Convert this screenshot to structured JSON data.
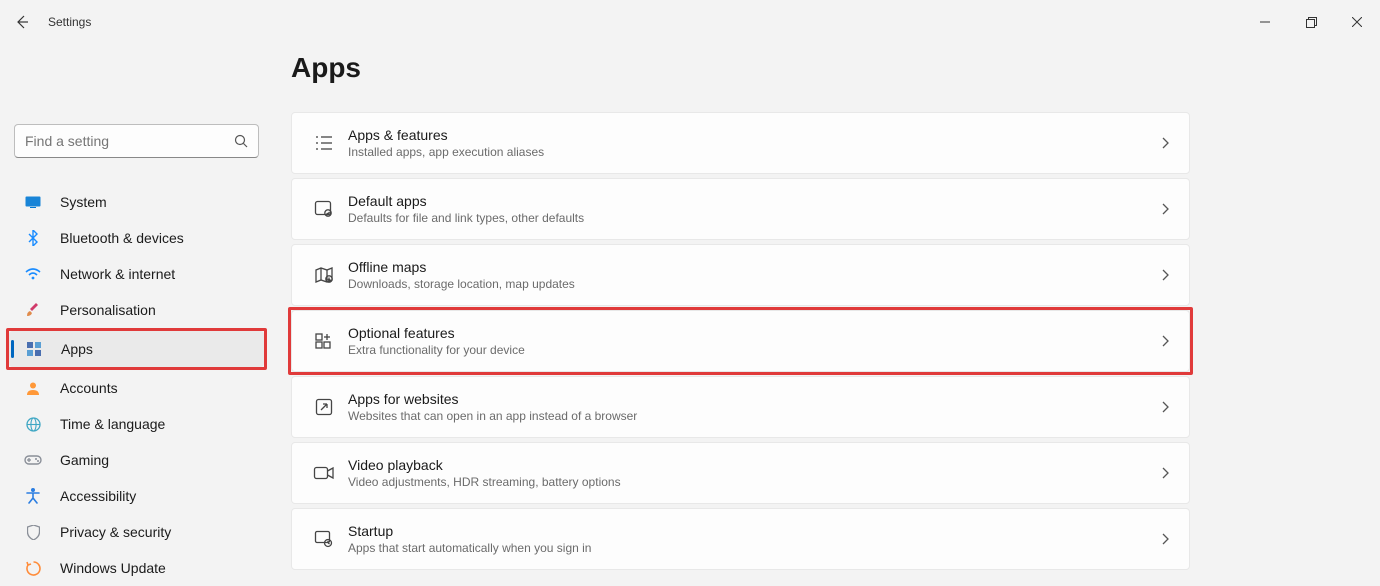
{
  "window": {
    "title": "Settings"
  },
  "search": {
    "placeholder": "Find a setting"
  },
  "sidebar": {
    "items": [
      {
        "label": "System",
        "icon": "system",
        "color": "#0078d4"
      },
      {
        "label": "Bluetooth & devices",
        "icon": "bluetooth",
        "color": "#1a8cff"
      },
      {
        "label": "Network & internet",
        "icon": "wifi",
        "color": "#1a8cff"
      },
      {
        "label": "Personalisation",
        "icon": "brush",
        "color": "#d03a6a"
      },
      {
        "label": "Apps",
        "icon": "apps",
        "color": "#3e6db5",
        "active": true,
        "boxed": true
      },
      {
        "label": "Accounts",
        "icon": "account",
        "color": "#ff9838"
      },
      {
        "label": "Time & language",
        "icon": "globe",
        "color": "#3fa7c4"
      },
      {
        "label": "Gaming",
        "icon": "gamepad",
        "color": "#8a8f98"
      },
      {
        "label": "Accessibility",
        "icon": "accessibility",
        "color": "#2a7de1"
      },
      {
        "label": "Privacy & security",
        "icon": "shield",
        "color": "#8a8f98"
      },
      {
        "label": "Windows Update",
        "icon": "update",
        "color": "#ff8c3a"
      }
    ]
  },
  "page": {
    "title": "Apps",
    "cards": [
      {
        "icon": "apps-features",
        "title": "Apps & features",
        "sub": "Installed apps, app execution aliases"
      },
      {
        "icon": "default-apps",
        "title": "Default apps",
        "sub": "Defaults for file and link types, other defaults"
      },
      {
        "icon": "offline-maps",
        "title": "Offline maps",
        "sub": "Downloads, storage location, map updates"
      },
      {
        "icon": "optional",
        "title": "Optional features",
        "sub": "Extra functionality for your device",
        "boxed": true
      },
      {
        "icon": "websites",
        "title": "Apps for websites",
        "sub": "Websites that can open in an app instead of a browser"
      },
      {
        "icon": "video",
        "title": "Video playback",
        "sub": "Video adjustments, HDR streaming, battery options"
      },
      {
        "icon": "startup",
        "title": "Startup",
        "sub": "Apps that start automatically when you sign in"
      }
    ]
  }
}
